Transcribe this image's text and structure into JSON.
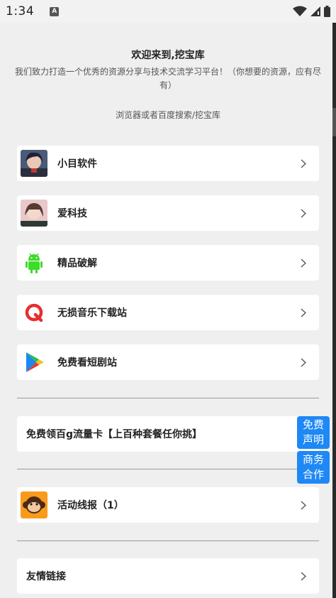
{
  "status_bar": {
    "time": "1:34",
    "notification_letter": "A",
    "icons": [
      "wifi-icon",
      "signal-icon",
      "battery-icon"
    ]
  },
  "header": {
    "title": "欢迎来到,挖宝库",
    "description": "我们致力打造一个优秀的资源分享与技术交流学习平台！（你想要的资源，应有尽有）",
    "hint": "浏览器或者百度搜索/挖宝库"
  },
  "links": [
    {
      "label": "小目软件",
      "icon": "anime-avatar-icon"
    },
    {
      "label": "爱科技",
      "icon": "portrait-avatar-icon"
    },
    {
      "label": "精品破解",
      "icon": "android-robot-icon"
    },
    {
      "label": "无损音乐下载站",
      "icon": "music-q-logo-icon"
    },
    {
      "label": "免费看短剧站",
      "icon": "play-store-icon"
    }
  ],
  "promo": {
    "label": "免费领百g流量卡【上百种套餐任你挑】"
  },
  "activity": {
    "label": "活动线报（1）",
    "icon": "monkey-icon"
  },
  "friend_links": {
    "label": "友情链接"
  },
  "float_buttons": {
    "disclaimer": [
      "免费",
      "声明"
    ],
    "business": [
      "商务",
      "合作"
    ]
  },
  "colors": {
    "accent": "#1e88f5",
    "background": "#efefef",
    "card": "#ffffff"
  }
}
